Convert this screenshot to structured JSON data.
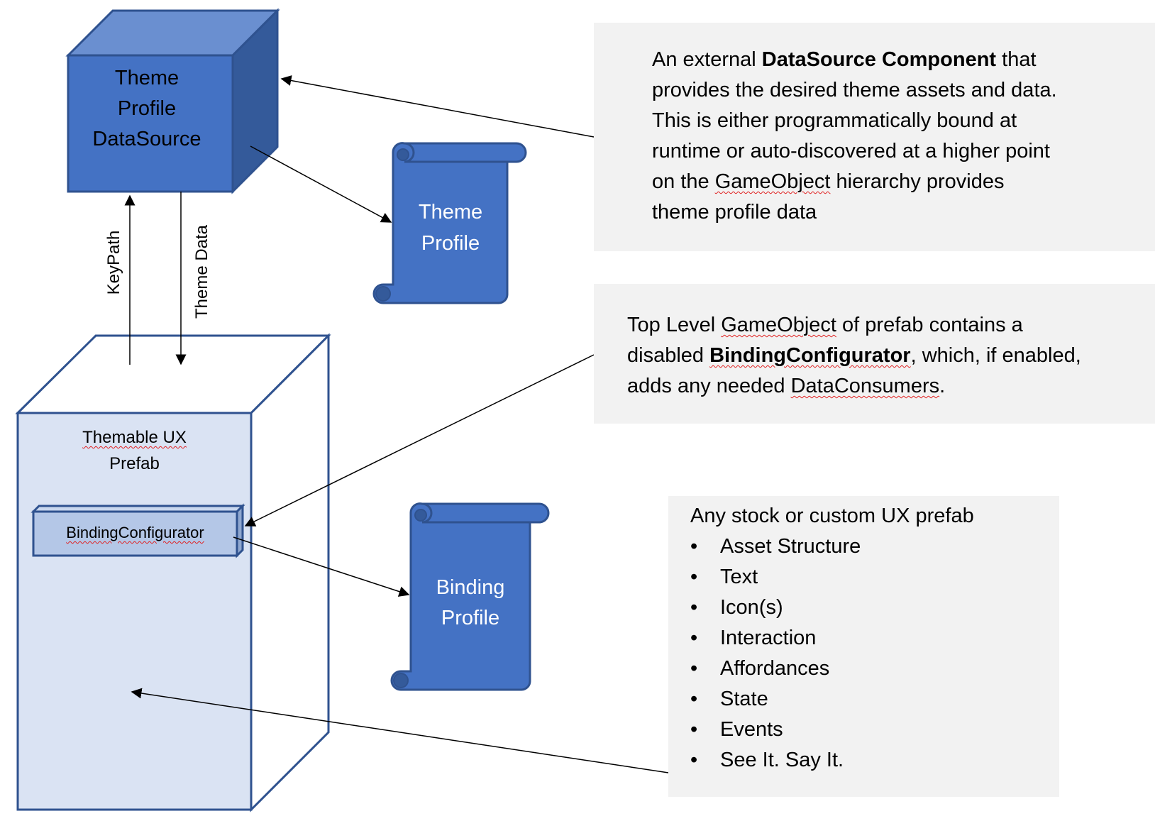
{
  "colors": {
    "cube_front": "#4472c4",
    "cube_top": "#6a8fd0",
    "cube_side": "#345a9a",
    "outline": "#2f528f",
    "prefab_front": "#dae3f3",
    "configurator_fill": "#b4c7e7",
    "note_bg": "#f2f2f2",
    "arrow": "#000000"
  },
  "datasource_cube": {
    "lines": [
      "Theme",
      "Profile",
      "DataSource"
    ]
  },
  "theme_profile_scroll": {
    "lines": [
      "Theme",
      "Profile"
    ]
  },
  "binding_profile_scroll": {
    "lines": [
      "Binding",
      "Profile"
    ]
  },
  "connectors": {
    "keypath_label": "KeyPath",
    "theme_data_label": "Theme Data"
  },
  "prefab_cube": {
    "title_line1": "Themable UX",
    "title_line2": "Prefab",
    "configurator_label": "BindingConfigurator"
  },
  "note_datasource": {
    "prefix": "An external ",
    "bold": "DataSource Component",
    "line1_suffix": " that",
    "line2": "provides the desired theme assets and data.",
    "line3": "This is either programmatically bound at",
    "line4": "runtime or auto-discovered at a higher point",
    "line5_prefix": "on the ",
    "line5_squiggle": "GameObject",
    "line5_suffix": " hierarchy provides",
    "line6": "theme profile data"
  },
  "note_configurator": {
    "line1_prefix": "Top Level ",
    "line1_squiggle": "GameObject",
    "line1_suffix": " of prefab contains a",
    "line2_prefix": "disabled ",
    "line2_bold": "BindingConfigurator",
    "line2_suffix": ", which, if enabled,",
    "line3_prefix": "adds any needed ",
    "line3_squiggle": "DataConsumers",
    "line3_suffix": "."
  },
  "note_prefab": {
    "heading": "Any stock or custom UX prefab",
    "bullet_glyph": "•",
    "items": [
      "Asset Structure",
      "Text",
      "Icon(s)",
      "Interaction",
      "Affordances",
      "State",
      "Events",
      "See It. Say It."
    ]
  }
}
